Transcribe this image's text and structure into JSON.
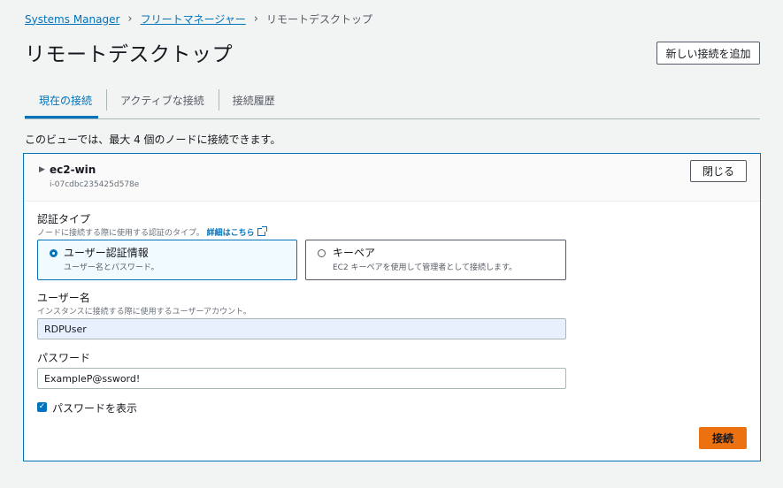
{
  "breadcrumb": {
    "items": [
      {
        "label": "Systems Manager"
      },
      {
        "label": "フリートマネージャー"
      },
      {
        "label": "リモートデスクトップ"
      }
    ]
  },
  "header": {
    "title": "リモートデスクトップ",
    "new_connection_label": "新しい接続を追加"
  },
  "tabs": [
    {
      "label": "現在の接続",
      "active": true
    },
    {
      "label": "アクティブな接続",
      "active": false
    },
    {
      "label": "接続履歴",
      "active": false
    }
  ],
  "info_text": "このビューでは、最大 4 個のノードに接続できます。",
  "session": {
    "node_name": "ec2-win",
    "node_id": "i-07cdbc235425d578e",
    "close_label": "閉じる",
    "auth_type": {
      "label": "認証タイプ",
      "description": "ノードに接続する際に使用する認証のタイプ。",
      "learn_more": "詳細はこちら",
      "options": [
        {
          "title": "ユーザー認証情報",
          "description": "ユーザー名とパスワード。",
          "selected": true
        },
        {
          "title": "キーペア",
          "description": "EC2 キーペアを使用して管理者として接続します。",
          "selected": false
        }
      ]
    },
    "username": {
      "label": "ユーザー名",
      "description": "インスタンスに接続する際に使用するユーザーアカウント。",
      "value": "RDPUser"
    },
    "password": {
      "label": "パスワード",
      "value": "ExampleP@ssword!"
    },
    "show_password": {
      "label": "パスワードを表示",
      "checked": true
    },
    "connect_label": "接続"
  },
  "colors": {
    "accent": "#0073bb",
    "primary_button": "#ec7211",
    "background": "#f2f3f3"
  }
}
